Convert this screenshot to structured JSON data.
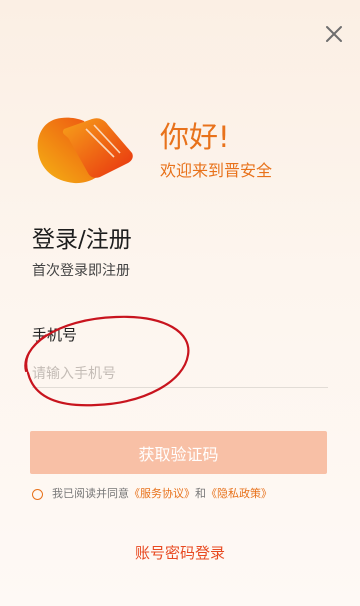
{
  "greeting": {
    "title": "你好!",
    "subtitle": "欢迎来到晋安全"
  },
  "login": {
    "title": "登录/注册",
    "subtitle": "首次登录即注册"
  },
  "phone": {
    "label": "手机号",
    "placeholder": "请输入手机号",
    "value": ""
  },
  "get_code_label": "获取验证码",
  "agreement": {
    "prefix": "我已阅读并同意",
    "service_link": "《服务协议》",
    "middle": "和",
    "privacy_link": "《隐私政策》",
    "checked": false
  },
  "password_login_label": "账号密码登录",
  "icons": {
    "close": "close-icon",
    "logo": "app-logo"
  },
  "colors": {
    "accent": "#e8721b",
    "button_disabled": "#f8c0a6",
    "password_link": "#e84a22",
    "annotation": "#c8141e"
  }
}
